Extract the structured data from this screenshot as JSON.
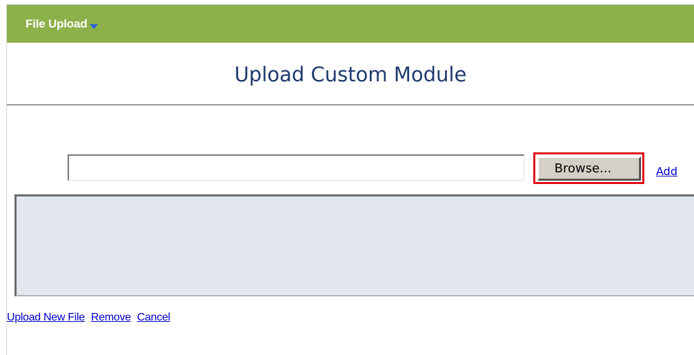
{
  "header": {
    "title": "File Upload",
    "caret_icon": "caret-down-icon",
    "background_color": "#8db14a"
  },
  "main": {
    "title": "Upload Custom Module"
  },
  "upload": {
    "file_path_value": "",
    "browse_label": "Browse...",
    "add_label": "Add",
    "highlight_color": "#e0101a"
  },
  "file_list": {
    "items": [],
    "background_color": "#e3e8f0"
  },
  "actions": {
    "upload_new_file_label": "Upload New File",
    "remove_label": "Remove",
    "cancel_label": "Cancel"
  }
}
